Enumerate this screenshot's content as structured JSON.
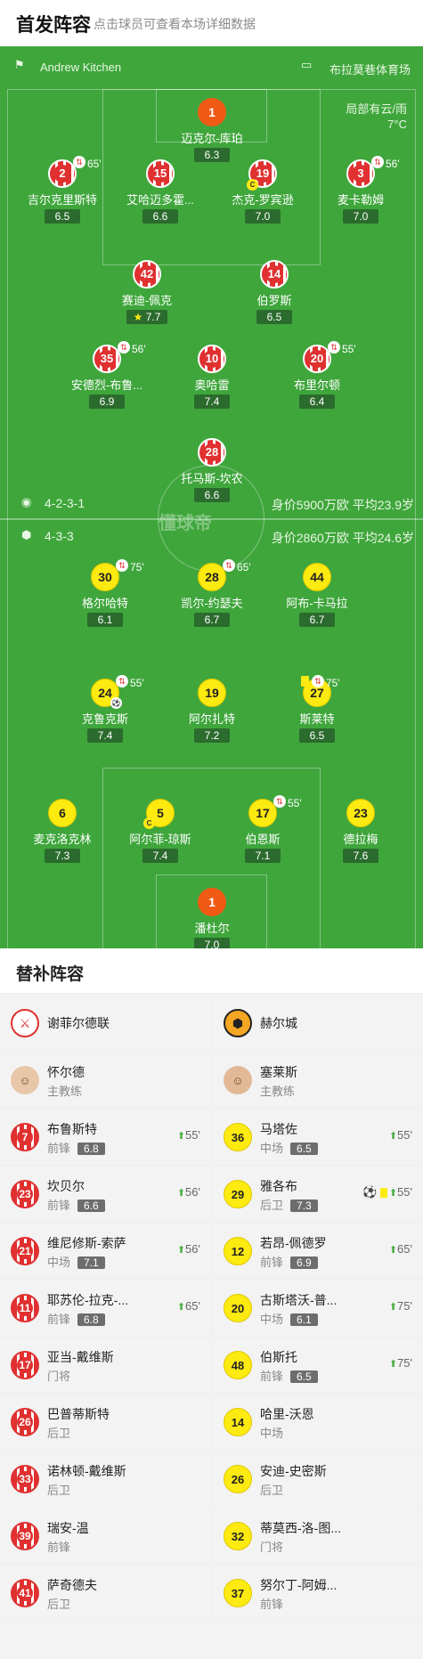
{
  "header": {
    "title": "首发阵容",
    "subtitle": "点击球员可查看本场详细数据"
  },
  "pitch": {
    "referee": "Andrew Kitchen",
    "stadium": "布拉莫巷体育场",
    "weather": "局部有云/雨",
    "temperature": "7°C",
    "watermark": "懂球帝",
    "home": {
      "formation": "4-2-3-1",
      "info": "身价5900万欧 平均23.9岁"
    },
    "away": {
      "formation": "4-3-3",
      "info": "身价2860万欧 平均24.6岁"
    }
  },
  "home_players": [
    {
      "num": "1",
      "name": "迈克尔-库珀",
      "rating": "6.3",
      "gk": true
    },
    {
      "num": "2",
      "name": "吉尔克里斯特",
      "rating": "6.5",
      "sub": "65'"
    },
    {
      "num": "15",
      "name": "艾哈迈多霍...",
      "rating": "6.6"
    },
    {
      "num": "19",
      "name": "杰克-罗宾逊",
      "rating": "7.0",
      "cap": true
    },
    {
      "num": "3",
      "name": "麦卡勒姆",
      "rating": "7.0",
      "sub": "56'"
    },
    {
      "num": "42",
      "name": "赛迪-佩克",
      "rating": "7.7",
      "star": true
    },
    {
      "num": "14",
      "name": "伯罗斯",
      "rating": "6.5"
    },
    {
      "num": "35",
      "name": "安德烈-布鲁...",
      "rating": "6.9",
      "sub": "56'"
    },
    {
      "num": "10",
      "name": "奥哈雷",
      "rating": "7.4"
    },
    {
      "num": "20",
      "name": "布里尔顿",
      "rating": "6.4",
      "sub": "55'"
    },
    {
      "num": "28",
      "name": "托马斯-坎农",
      "rating": "6.6"
    }
  ],
  "away_players": [
    {
      "num": "30",
      "name": "格尔哈特",
      "rating": "6.1",
      "sub": "75'"
    },
    {
      "num": "28",
      "name": "凯尔-约瑟夫",
      "rating": "6.7",
      "sub": "65'"
    },
    {
      "num": "44",
      "name": "阿布-卡马拉",
      "rating": "6.7"
    },
    {
      "num": "24",
      "name": "克鲁克斯",
      "rating": "7.4",
      "sub": "55'",
      "goal": true
    },
    {
      "num": "19",
      "name": "阿尔扎特",
      "rating": "7.2"
    },
    {
      "num": "27",
      "name": "斯莱特",
      "rating": "6.5",
      "sub": "75'",
      "yellow": true
    },
    {
      "num": "6",
      "name": "麦克洛克林",
      "rating": "7.3"
    },
    {
      "num": "5",
      "name": "阿尔菲-琼斯",
      "rating": "7.4",
      "cap": true
    },
    {
      "num": "17",
      "name": "伯恩斯",
      "rating": "7.1",
      "sub": "55'"
    },
    {
      "num": "23",
      "name": "德拉梅",
      "rating": "7.6"
    },
    {
      "num": "1",
      "name": "潘杜尔",
      "rating": "7.0",
      "gk": true
    }
  ],
  "subs": {
    "title": "替补阵容",
    "home": {
      "team": "谢菲尔德联",
      "coach": "怀尔德",
      "coach_role": "主教练",
      "players": [
        {
          "num": "7",
          "name": "布鲁斯特",
          "pos": "前锋",
          "rating": "6.8",
          "in": "55'"
        },
        {
          "num": "23",
          "name": "坎贝尔",
          "pos": "前锋",
          "rating": "6.6",
          "in": "56'"
        },
        {
          "num": "21",
          "name": "维尼修斯-索萨",
          "pos": "中场",
          "rating": "7.1",
          "in": "56'"
        },
        {
          "num": "11",
          "name": "耶苏伦-拉克-...",
          "pos": "前锋",
          "rating": "6.8",
          "in": "65'"
        },
        {
          "num": "17",
          "name": "亚当-戴维斯",
          "pos": "门将"
        },
        {
          "num": "26",
          "name": "巴普蒂斯特",
          "pos": "后卫"
        },
        {
          "num": "33",
          "name": "诺林顿-戴维斯",
          "pos": "后卫"
        },
        {
          "num": "39",
          "name": "瑞安-温",
          "pos": "前锋"
        },
        {
          "num": "41",
          "name": "萨奇德夫",
          "pos": "后卫"
        }
      ]
    },
    "away": {
      "team": "赫尔城",
      "coach": "塞莱斯",
      "coach_role": "主教练",
      "players": [
        {
          "num": "36",
          "name": "马塔佐",
          "pos": "中场",
          "rating": "6.5",
          "in": "55'"
        },
        {
          "num": "29",
          "name": "雅各布",
          "pos": "后卫",
          "rating": "7.3",
          "in": "55'",
          "goal": true,
          "yellow": true
        },
        {
          "num": "12",
          "name": "若昂-佩德罗",
          "pos": "前锋",
          "rating": "6.9",
          "in": "65'"
        },
        {
          "num": "20",
          "name": "古斯塔沃-普...",
          "pos": "中场",
          "rating": "6.1",
          "in": "75'"
        },
        {
          "num": "48",
          "name": "伯斯托",
          "pos": "前锋",
          "rating": "6.5",
          "in": "75'"
        },
        {
          "num": "14",
          "name": "哈里-沃恩",
          "pos": "中场"
        },
        {
          "num": "26",
          "name": "安迪-史密斯",
          "pos": "后卫"
        },
        {
          "num": "32",
          "name": "蒂莫西-洛-图...",
          "pos": "门将"
        },
        {
          "num": "37",
          "name": "努尔丁-阿姆...",
          "pos": "前锋"
        }
      ]
    }
  },
  "colors": {
    "pitch": "#3fa63c",
    "home": "#e03030",
    "away": "#fdea10",
    "gk": "#f05a14"
  }
}
